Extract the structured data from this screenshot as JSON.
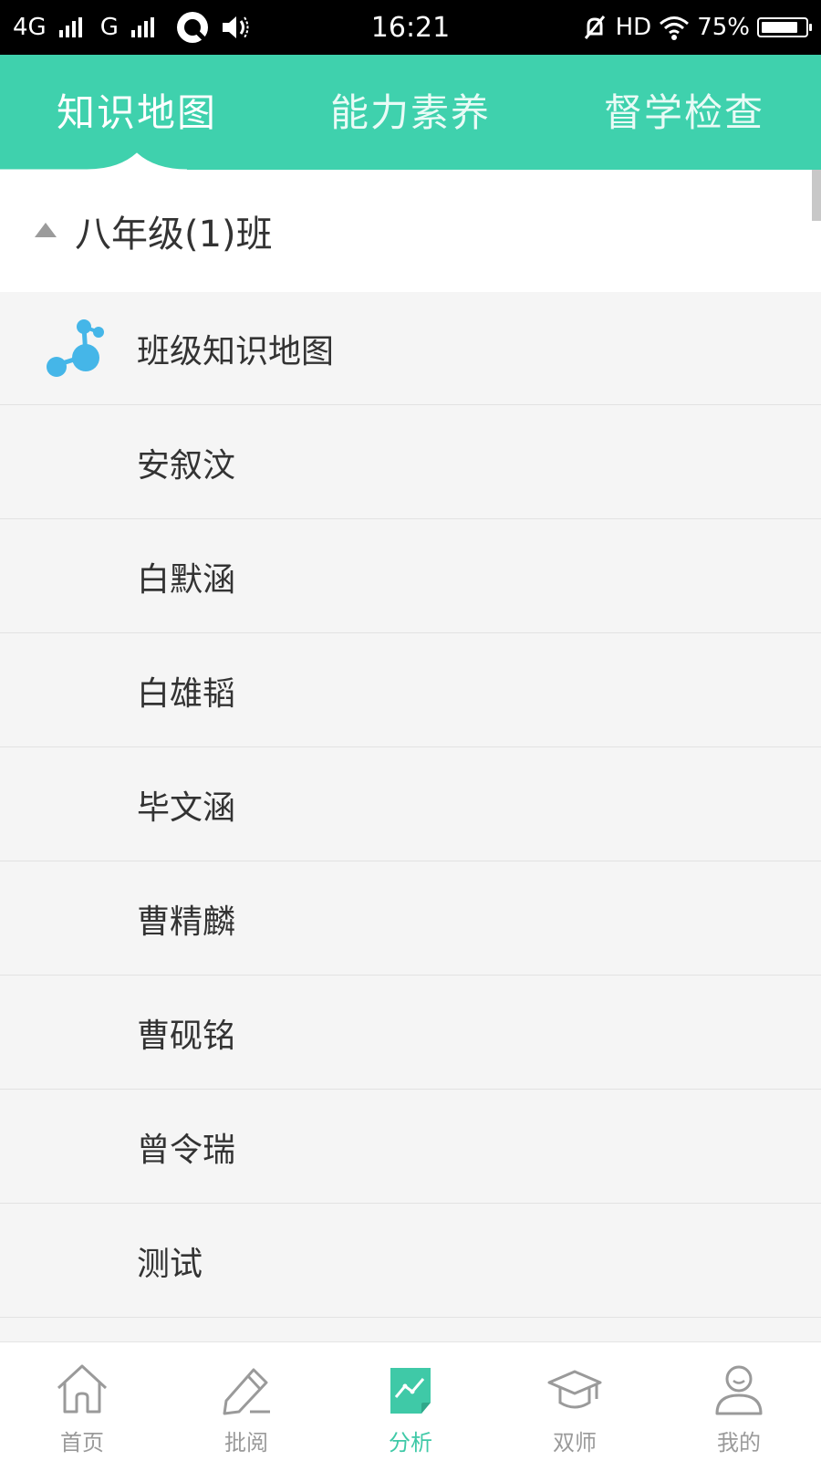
{
  "status_bar": {
    "network_1": "4G",
    "network_2": "G",
    "time": "16:21",
    "hd": "HD",
    "battery": "75%"
  },
  "tabs": [
    {
      "label": "知识地图",
      "active": true
    },
    {
      "label": "能力素养",
      "active": false
    },
    {
      "label": "督学检查",
      "active": false
    }
  ],
  "class_group": {
    "label": "八年级(1)班",
    "expanded": true
  },
  "list": {
    "items": [
      {
        "label": "班级知识地图",
        "icon": "knowledge-map-icon"
      },
      {
        "label": "安叙汶"
      },
      {
        "label": "白默涵"
      },
      {
        "label": "白雄韬"
      },
      {
        "label": "毕文涵"
      },
      {
        "label": "曹精麟"
      },
      {
        "label": "曹砚铭"
      },
      {
        "label": "曾令瑞"
      },
      {
        "label": "测试"
      }
    ]
  },
  "bottom_nav": [
    {
      "label": "首页",
      "icon": "home-icon",
      "active": false
    },
    {
      "label": "批阅",
      "icon": "edit-icon",
      "active": false
    },
    {
      "label": "分析",
      "icon": "analysis-icon",
      "active": true
    },
    {
      "label": "双师",
      "icon": "graduation-cap-icon",
      "active": false
    },
    {
      "label": "我的",
      "icon": "user-icon",
      "active": false
    }
  ],
  "colors": {
    "accent": "#3fd1ad",
    "active_nav": "#3fc9a7",
    "inactive_nav": "#9a9a9a",
    "icon_blue": "#45b6e8"
  }
}
